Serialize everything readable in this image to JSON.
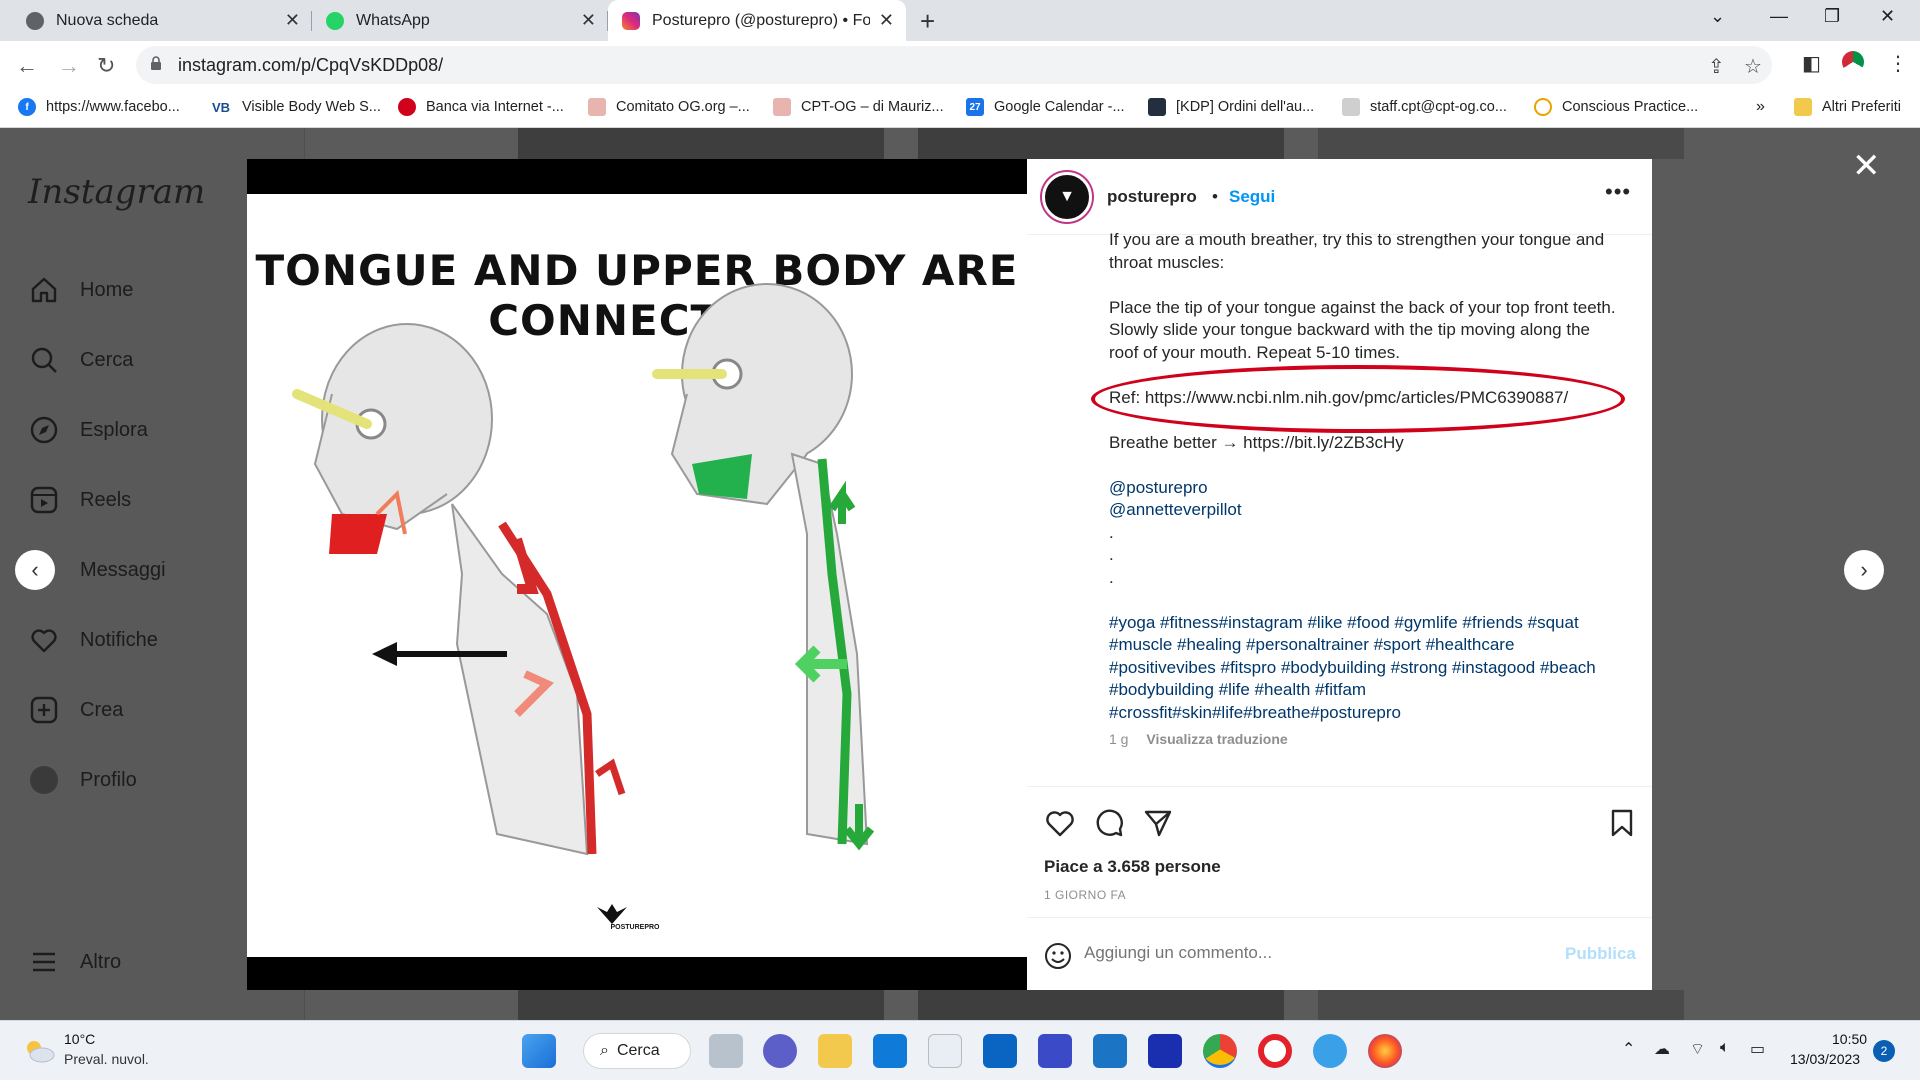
{
  "browser": {
    "tabs": [
      {
        "title": "Nuova scheda",
        "icon": "chrome-icon"
      },
      {
        "title": "WhatsApp",
        "icon": "whatsapp-icon"
      },
      {
        "title": "Posturepro (@posturepro) • Foto",
        "icon": "instagram-icon",
        "active": true
      }
    ],
    "url": "instagram.com/p/CpqVsKDDp08/",
    "bookmarks": [
      {
        "label": "https://www.facebo...",
        "icon": "facebook-icon",
        "color": "#1877f2"
      },
      {
        "label": "Visible Body Web S...",
        "icon": "visiblebody-icon",
        "color": "#1a4d8f",
        "badge": "VB"
      },
      {
        "label": "Banca via Internet -...",
        "icon": "bank-icon",
        "color": "#d0021b"
      },
      {
        "label": "Comitato OG.org –...",
        "icon": "org-icon",
        "color": "#c0392b"
      },
      {
        "label": "CPT-OG – di Mauriz...",
        "icon": "org-icon",
        "color": "#c0392b"
      },
      {
        "label": "Google Calendar -...",
        "icon": "calendar-icon",
        "color": "#1a73e8",
        "badge": "27"
      },
      {
        "label": "[KDP] Ordini dell'au...",
        "icon": "kdp-icon",
        "color": "#232f3e"
      },
      {
        "label": "staff.cpt@cpt-og.co...",
        "icon": "mail-icon",
        "color": "#999999"
      },
      {
        "label": "Conscious Practice...",
        "icon": "conscious-icon",
        "color": "#e8a400"
      }
    ],
    "more_bookmarks": "»",
    "other_favorites": "Altri Preferiti"
  },
  "instagram": {
    "logo": "Instagram",
    "nav": [
      {
        "label": "Home",
        "icon": "home-icon"
      },
      {
        "label": "Cerca",
        "icon": "search-icon"
      },
      {
        "label": "Esplora",
        "icon": "compass-icon"
      },
      {
        "label": "Reels",
        "icon": "reels-icon"
      },
      {
        "label": "Messaggi",
        "icon": "messenger-icon"
      },
      {
        "label": "Notifiche",
        "icon": "heart-icon"
      },
      {
        "label": "Crea",
        "icon": "create-icon"
      },
      {
        "label": "Profilo",
        "icon": "profile-avatar"
      }
    ],
    "more_label": "Altro"
  },
  "post": {
    "poster_title": "TONGUE AND UPPER BODY ARE CONNECTED",
    "poster_logo": "POSTUREPRO",
    "username": "posturepro",
    "follow": "Segui",
    "caption": {
      "intro": "If you are a mouth breather, try this to strengthen your tongue and throat muscles:",
      "instructions": "Place the tip of your tongue against the back of your top front teeth. Slowly slide your tongue backward with the tip moving along the roof of your mouth. Repeat 5-10 times.",
      "ref": "Ref: https://www.ncbi.nlm.nih.gov/pmc/articles/PMC6390887/",
      "breathe": "Breathe better → https://bit.ly/2ZB3cHy",
      "mention1": "@posturepro",
      "mention2": "@annetteverpillot",
      "dot": ".",
      "hashtags": "#yoga #fitness#instagram #like #food #gymlife #friends #squat #muscle #healing #personaltrainer #sport #healthcare #positivevibes #fitspro #bodybuilding #strong #instagood #beach #bodybuilding #life #health #fitfam #crossfit#skin#life#breathe#posturepro",
      "age": "1 g",
      "translate": "Visualizza traduzione"
    },
    "likes": "Piace a 3.658 persone",
    "date": "1 GIORNO FA",
    "comment_placeholder": "Aggiungi un commento...",
    "publish": "Pubblica"
  },
  "taskbar": {
    "temp": "10°C",
    "weather": "Preval. nuvol.",
    "search": "Cerca",
    "time": "10:50",
    "date": "13/03/2023",
    "notifications": "2"
  }
}
